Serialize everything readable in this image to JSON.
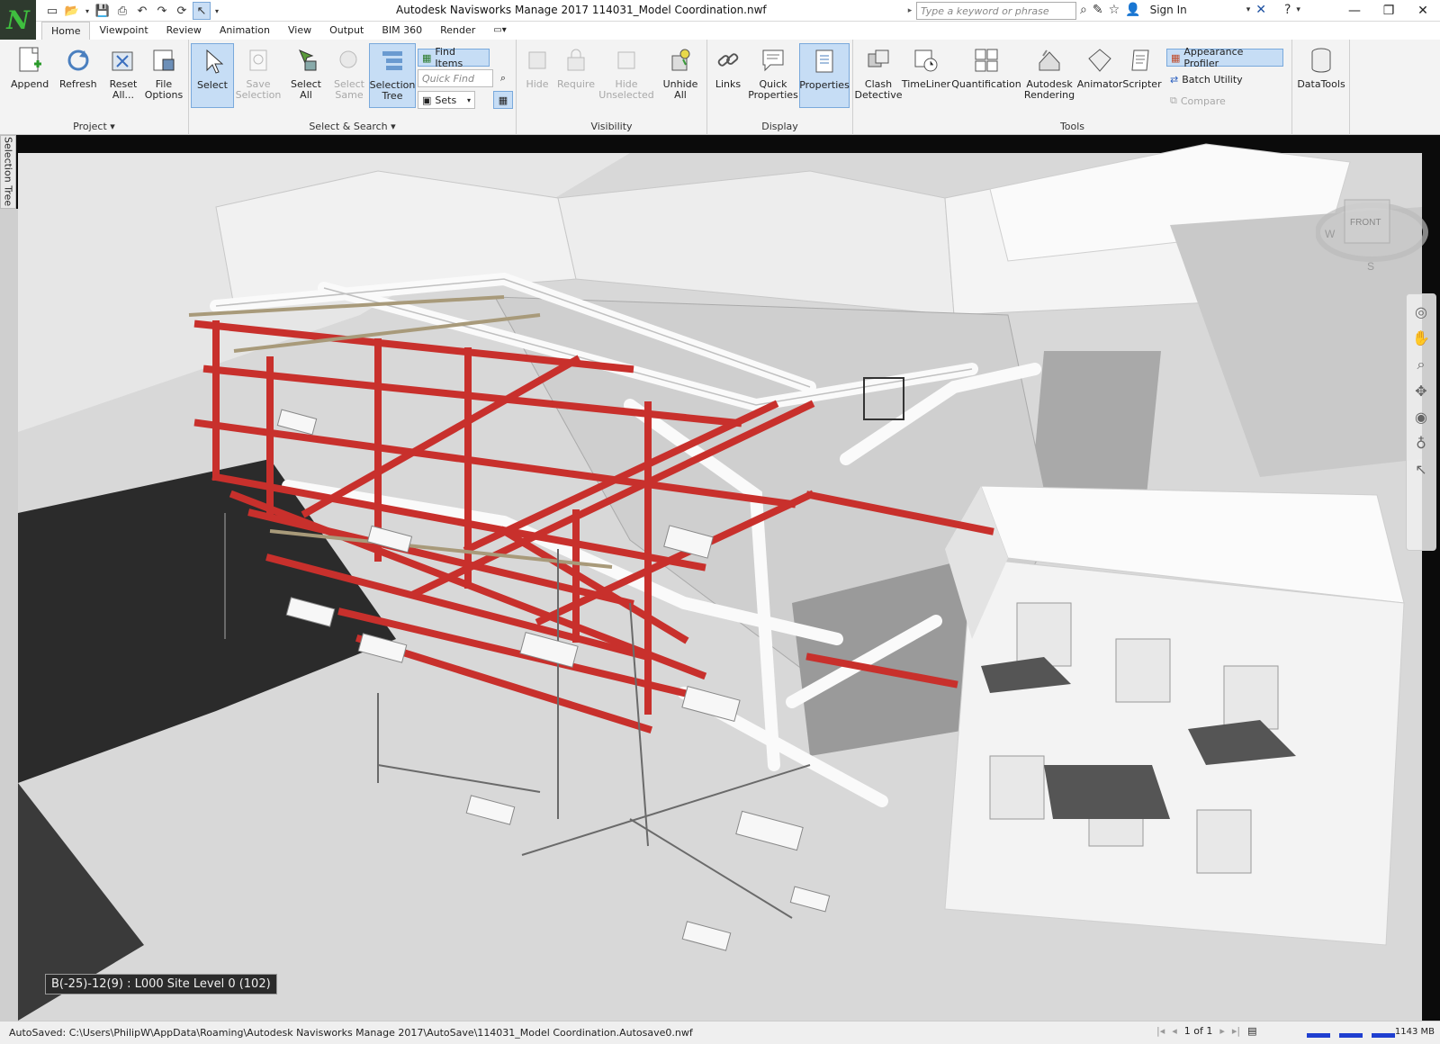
{
  "window": {
    "title": "Autodesk Navisworks Manage 2017    114031_Model Coordination.nwf",
    "logo": "N",
    "search_placeholder": "Type a keyword or phrase",
    "sign_in": "Sign In"
  },
  "tabs": [
    "Home",
    "Viewpoint",
    "Review",
    "Animation",
    "View",
    "Output",
    "BIM 360",
    "Render"
  ],
  "active_tab": "Home",
  "ribbon": {
    "project": {
      "title": "Project",
      "append": "Append",
      "refresh": "Refresh",
      "reset_all": "Reset All...",
      "file_options": "File Options"
    },
    "select_search": {
      "title": "Select & Search",
      "select": "Select",
      "save_selection": "Save Selection",
      "select_all": "Select All",
      "select_same": "Select Same",
      "selection_tree": "Selection Tree",
      "find_items": "Find Items",
      "quick_find": "Quick Find",
      "sets": "Sets"
    },
    "visibility": {
      "title": "Visibility",
      "hide": "Hide",
      "require": "Require",
      "hide_unselected": "Hide Unselected",
      "unhide_all": "Unhide All"
    },
    "display": {
      "title": "Display",
      "links": "Links",
      "quick_properties": "Quick Properties",
      "properties": "Properties"
    },
    "tools": {
      "title": "Tools",
      "clash_detective": "Clash Detective",
      "timeliner": "TimeLiner",
      "quantification": "Quantification",
      "autodesk_rendering": "Autodesk Rendering",
      "animator": "Animator",
      "scripter": "Scripter",
      "appearance_profiler": "Appearance Profiler",
      "batch_utility": "Batch Utility",
      "compare": "Compare"
    },
    "datatools": {
      "label": "DataTools"
    }
  },
  "side_tab": "Selection Tree",
  "viewcube": {
    "face": "FRONT",
    "compass": [
      "W",
      "S"
    ]
  },
  "viewport": {
    "coordinate_readout": "B(-25)-12(9) : L000 Site Level 0 (102)"
  },
  "status": {
    "autosave": "AutoSaved: C:\\Users\\PhilipW\\AppData\\Roaming\\Autodesk Navisworks Manage 2017\\AutoSave\\114031_Model Coordination.Autosave0.nwf",
    "page": "1 of 1",
    "memory": "1143 MB"
  },
  "colors": {
    "pipe_red": "#c8302c",
    "ribbon_bg": "#f3f3f3",
    "selected_blue": "#c6ddf5",
    "logo_green": "#3fbf3f"
  }
}
